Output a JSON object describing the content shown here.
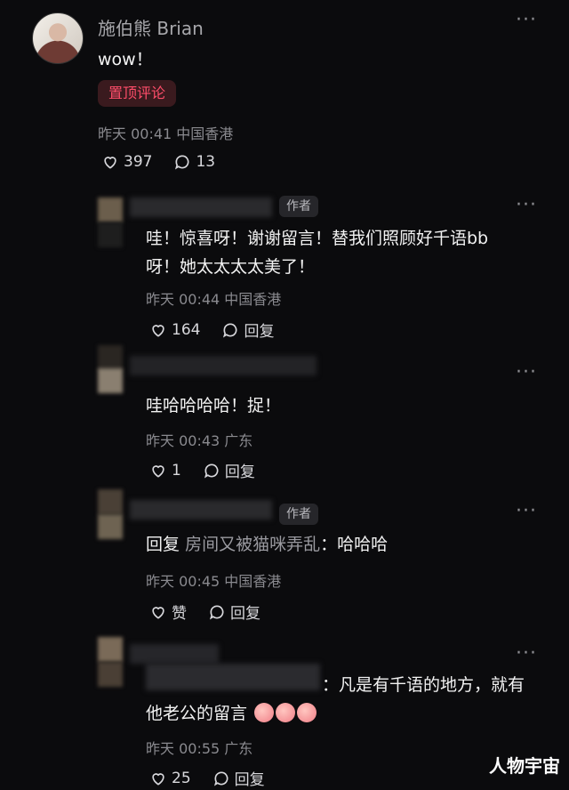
{
  "main_comment": {
    "username": "施伯熊 Brian",
    "text": "wow！",
    "pin_badge": "置顶评论",
    "time": "昨天 00:41",
    "location": "中国香港",
    "likes": "397",
    "replies": "13",
    "more_icon": "more-horizontal-icon"
  },
  "replies": [
    {
      "author_tag": "作者",
      "text_line1": "哇！惊喜呀！谢谢留言！替我们照顾好千语bb",
      "text_line2": "呀！她太太太太美了！",
      "time": "昨天 00:44",
      "location": "中国香港",
      "likes": "164",
      "reply_label": "回复"
    },
    {
      "text": "哇哈哈哈哈！捉！",
      "time": "昨天 00:43",
      "location": "广东",
      "likes": "1",
      "reply_label": "回复"
    },
    {
      "author_tag": "作者",
      "reply_prefix": "回复",
      "reply_target": "房间又被猫咪弄乱",
      "reply_tail": "：哈哈哈",
      "time": "昨天 00:45",
      "location": "中国香港",
      "like_label": "赞",
      "reply_label": "回复"
    },
    {
      "text_line1": "：凡是有千语的地方，就有",
      "text_line2": "他老公的留言",
      "emoji": "peach-emoji",
      "time": "昨天 00:55",
      "location": "广东",
      "likes": "25",
      "reply_label": "回复"
    }
  ],
  "watermark": "人物宇宙",
  "colors": {
    "background": "#0b0b0d",
    "pin": "#ff4d6a",
    "meta": "#8a8a8f"
  }
}
